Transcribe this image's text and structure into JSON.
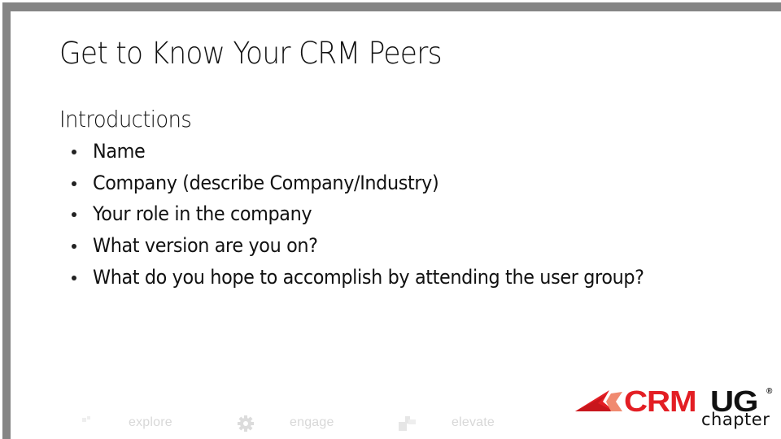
{
  "slide": {
    "title": "Get to Know Your CRM Peers",
    "section_heading": "Introductions",
    "bullets": [
      "Name",
      "Company (describe Company/Industry)",
      "Your role in the company",
      "What version are you on?",
      "What do you hope to accomplish by attending the user group?"
    ]
  },
  "footer": {
    "items": [
      {
        "label": "explore",
        "icon": "compass-icon"
      },
      {
        "label": "engage",
        "icon": "gear-icon"
      },
      {
        "label": "elevate",
        "icon": "blocks-icon"
      }
    ]
  },
  "logo": {
    "brand_red": "CRM",
    "brand_black": "UG",
    "registered_mark": "®",
    "subtitle": "chapter",
    "colors": {
      "red": "#e31e24",
      "peach": "#f08a70",
      "black": "#111111"
    }
  },
  "theme": {
    "frame_gray": "#858585",
    "background": "#ffffff",
    "footer_text": "#d8d8d8"
  }
}
